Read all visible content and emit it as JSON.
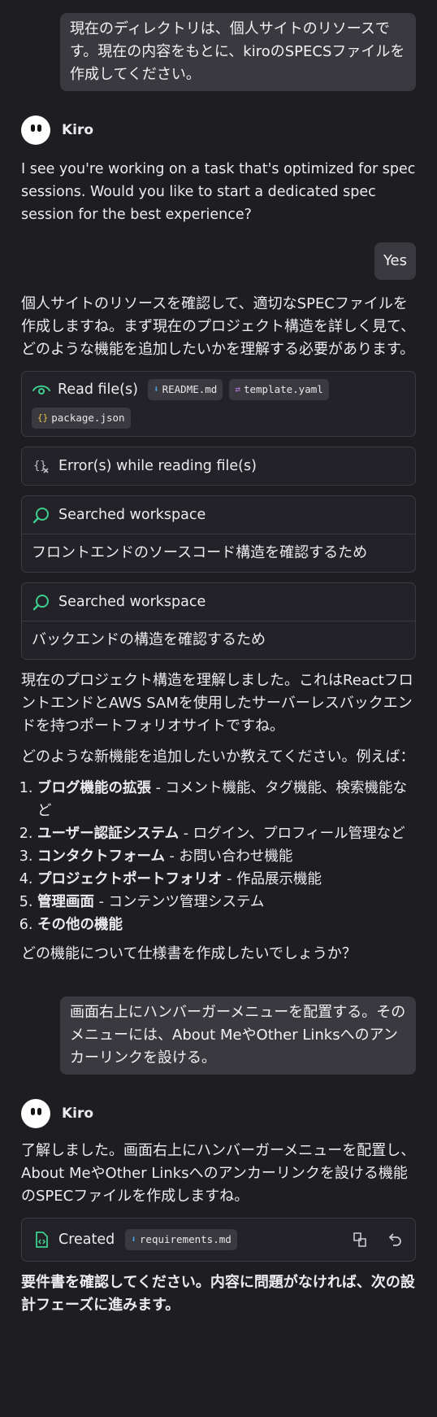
{
  "conversation": {
    "user_msg_1": "現在のディレクトリは、個人サイトのリソースです。現在の内容をもとに、kiroのSPECSファイルを作成してください。",
    "kiro_name": "Kiro",
    "kiro_msg_1": "I see you're working on a task that's optimized for spec sessions. Would you like to start a dedicated spec session for the best experience?",
    "user_msg_2": "Yes",
    "kiro_msg_2": "個人サイトのリソースを確認して、適切なSPECファイルを作成しますね。まず現在のプロジェクト構造を詳しく見て、どのような機能を追加したいかを理解する必要があります。",
    "read_files": {
      "label": "Read file(s)",
      "files": [
        {
          "name": "README.md",
          "icon": "markdown-file-icon",
          "icon_glyph": "⬇",
          "color": "#4aa3df"
        },
        {
          "name": "template.yaml",
          "icon": "yaml-file-icon",
          "icon_glyph": "⇄",
          "color": "#b57edc"
        },
        {
          "name": "package.json",
          "icon": "json-file-icon",
          "icon_glyph": "{}",
          "color": "#e8c547"
        }
      ]
    },
    "error_label": "Error(s) while reading file(s)",
    "search_1": {
      "label": "Searched workspace",
      "detail": "フロントエンドのソースコード構造を確認するため"
    },
    "search_2": {
      "label": "Searched workspace",
      "detail": "バックエンドの構造を確認するため"
    },
    "kiro_msg_3": "現在のプロジェクト構造を理解しました。これはReactフロントエンドとAWS SAMを使用したサーバーレスバックエンドを持つポートフォリオサイトですね。",
    "kiro_msg_4": "どのような新機能を追加したいか教えてください。例えば：",
    "feature_list": [
      {
        "title": "ブログ機能の拡張",
        "desc": " - コメント機能、タグ機能、検索機能など"
      },
      {
        "title": "ユーザー認証システム",
        "desc": " - ログイン、プロフィール管理など"
      },
      {
        "title": "コンタクトフォーム",
        "desc": " - お問い合わせ機能"
      },
      {
        "title": "プロジェクトポートフォリオ",
        "desc": " - 作品展示機能"
      },
      {
        "title": "管理画面",
        "desc": " - コンテンツ管理システム"
      },
      {
        "title": "その他の機能",
        "desc": ""
      }
    ],
    "kiro_msg_5": "どの機能について仕様書を作成したいでしょうか？",
    "user_msg_3": "画面右上にハンバーガーメニューを配置する。そのメニューには、About MeやOther Linksへのアンカーリンクを設ける。",
    "kiro_msg_6": "了解しました。画面右上にハンバーガーメニューを配置し、About MeやOther Linksへのアンカーリンクを設ける機能のSPECファイルを作成しますね。",
    "created": {
      "label": "Created",
      "file": "requirements.md",
      "icon": "markdown-file-icon"
    },
    "kiro_msg_7": "要件書を確認してください。内容に問題がなければ、次の設計フェーズに進みます。"
  },
  "colors": {
    "background": "#1e1d22",
    "user_bubble": "#3a393f",
    "accent_green": "#3ecf8e",
    "card_border": "#3b3a40"
  }
}
